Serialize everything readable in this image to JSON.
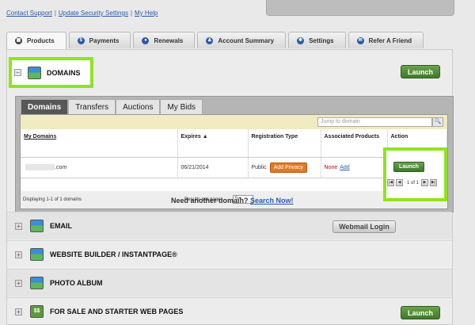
{
  "top_links": {
    "contact": "Contact Support",
    "update": "Update Security Settings",
    "help": "My Help",
    "sep": "|"
  },
  "tabs": [
    {
      "label": "Products",
      "icon": "box-icon"
    },
    {
      "label": "Payments",
      "icon": "dollar-icon"
    },
    {
      "label": "Renewals",
      "icon": "clock-icon"
    },
    {
      "label": "Account Summary",
      "icon": "person-icon"
    },
    {
      "label": "Settings",
      "icon": "gear-icon"
    },
    {
      "label": "Refer A Friend",
      "icon": "chat-icon"
    }
  ],
  "domains_section": {
    "title": "DOMAINS",
    "collapse_symbol": "–",
    "launch_label": "Launch",
    "subtabs": [
      "Domains",
      "Transfers",
      "Auctions",
      "My Bids"
    ],
    "search_placeholder": "Jump to domain",
    "search_button": "🔍",
    "columns": [
      "My Domains",
      "Expires ▲",
      "Registration Type",
      "Associated Products",
      "Action"
    ],
    "row": {
      "domain_suffix": ".com",
      "expires": "06/21/2014",
      "registration_type": "Public",
      "add_privacy": "Add Privacy",
      "associated_none": "None",
      "associated_add": "Add",
      "launch_label": "Launch"
    },
    "displaying": "Displaying 1-1 of 1 domains",
    "results_per_page_label": "Results per page:",
    "results_per_page_value": "5",
    "results_per_page_caret": "▾",
    "pager_text": "1 of 1",
    "pager_first": "|◀",
    "pager_prev": "◀",
    "pager_next": "▶",
    "pager_last": "▶|",
    "need_another": "Need another domain?",
    "search_now": "Search Now!"
  },
  "sections": [
    {
      "title": "EMAIL",
      "button": "Webmail Login"
    },
    {
      "title": "WEBSITE BUILDER / INSTANTPAGE®"
    },
    {
      "title": "PHOTO ALBUM"
    },
    {
      "title": "FOR SALE AND STARTER WEB PAGES",
      "button": "Launch"
    }
  ],
  "expand_symbol": "+",
  "tab_glyphs": {
    "products": "▣",
    "payments": "$",
    "renewals": "●",
    "account": "♟",
    "settings": "✱",
    "refer": "✉"
  },
  "forsale_icon_text": "$$"
}
